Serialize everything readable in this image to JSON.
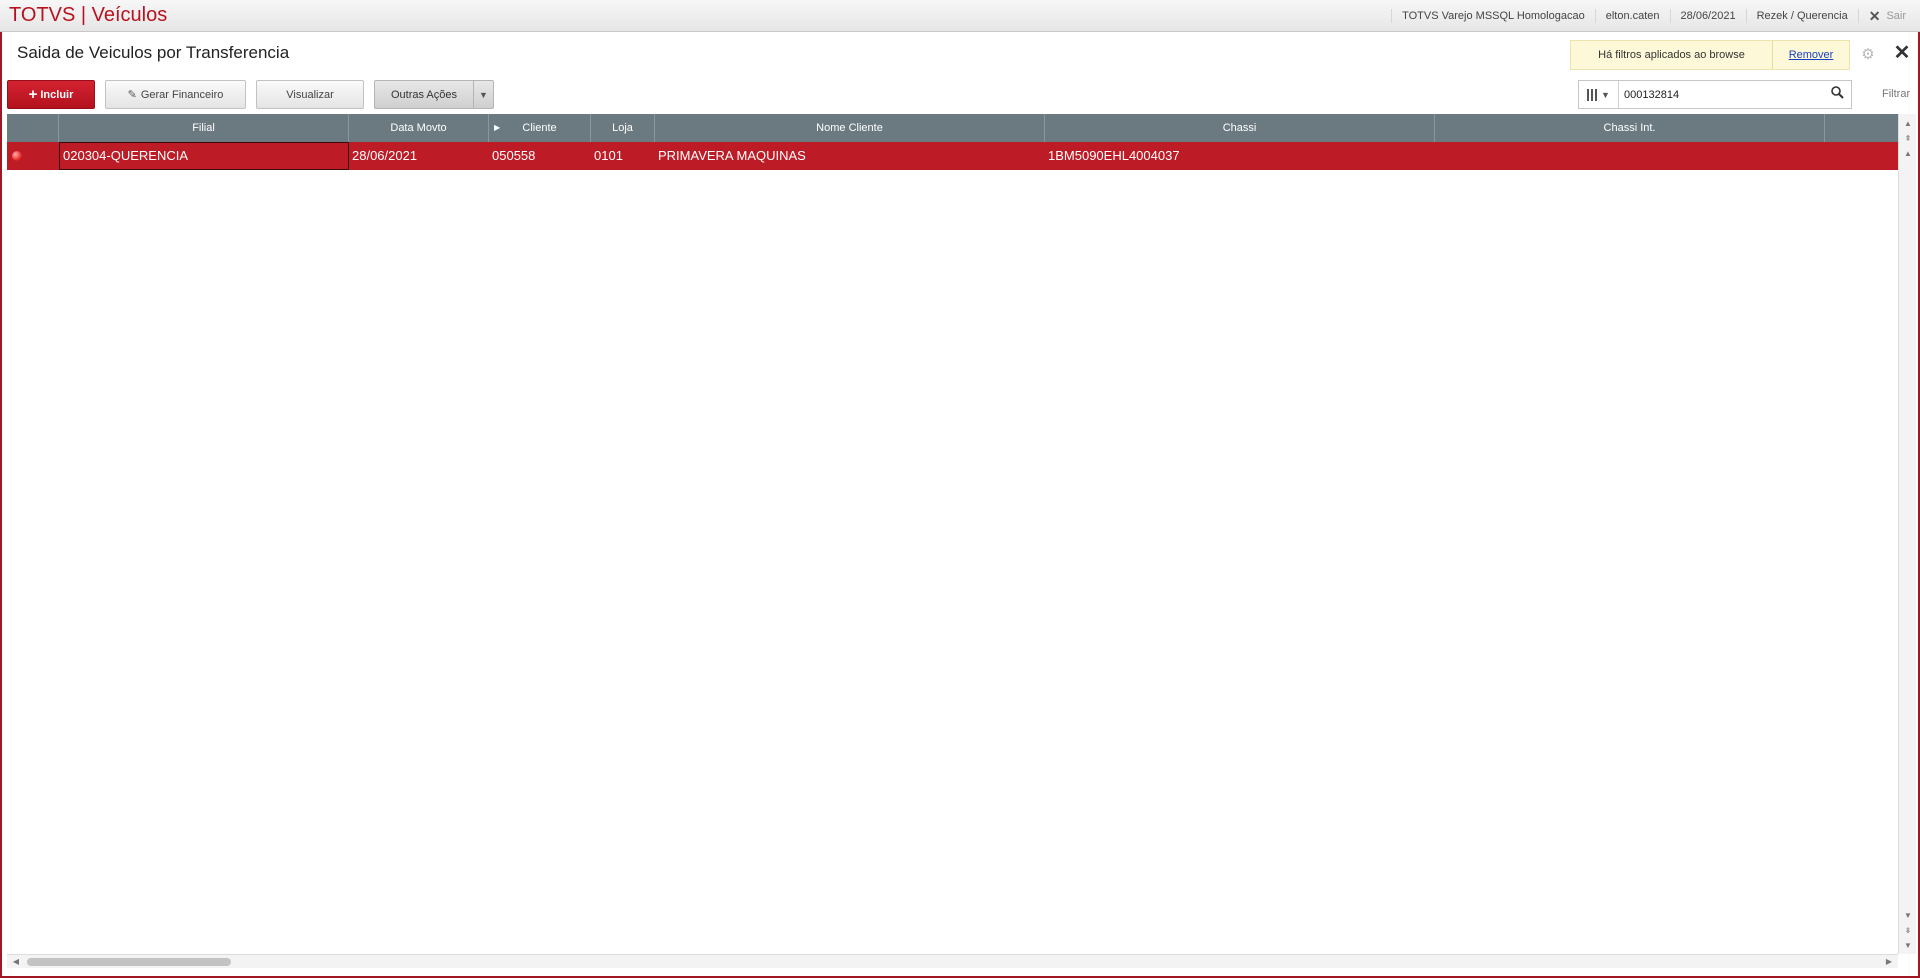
{
  "app": {
    "title": "TOTVS | Veículos"
  },
  "topbar": {
    "environment": "TOTVS Varejo MSSQL Homologacao",
    "user": "elton.caten",
    "date": "28/06/2021",
    "branch": "Rezek / Querencia",
    "exit_label": "Sair",
    "exit_icon": "close-icon"
  },
  "page": {
    "title": "Saida de Veiculos por Transferencia",
    "filter_notice": "Há filtros aplicados ao browse",
    "remove_label": "Remover"
  },
  "toolbar": {
    "add_label": "Incluir",
    "finance_label": "Gerar Financeiro",
    "view_label": "Visualizar",
    "more_label": "Outras Ações"
  },
  "search": {
    "value": "000132814",
    "filter_label": "Filtrar"
  },
  "grid": {
    "columns": [
      "Filial",
      "Data Movto",
      "Cliente",
      "Loja",
      "Nome Cliente",
      "Chassi",
      "Chassi Int."
    ],
    "rows": [
      {
        "status": "red",
        "filial": "020304-QUERENCIA",
        "data_movto": "28/06/2021",
        "cliente": "050558",
        "loja": "0101",
        "nome_cliente": "PRIMAVERA MAQUINAS",
        "chassi": "1BM5090EHL4004037",
        "chassi_int": ""
      }
    ]
  },
  "colors": {
    "accent": "#b7121f",
    "header_bg": "#6b7a80",
    "selected_row": "#bd1b26",
    "notice_bg": "#fdf8d8"
  }
}
